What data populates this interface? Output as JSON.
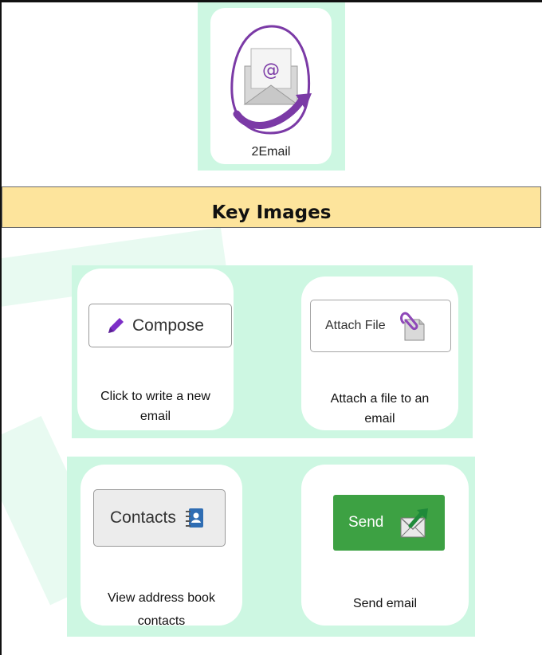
{
  "app": {
    "logo_caption": "2Email"
  },
  "banner": {
    "title": "Key Images"
  },
  "items": [
    {
      "button_label": "Compose",
      "icon": "pencil-icon",
      "caption_line1": "Click to write a new",
      "caption_line2": "email"
    },
    {
      "button_label": "Attach File",
      "icon": "paperclip-file-icon",
      "caption_line1": "Attach a file to an",
      "caption_line2": "email"
    },
    {
      "button_label": "Contacts",
      "icon": "address-book-icon",
      "caption_line1": "View address book",
      "caption_line2": "contacts"
    },
    {
      "button_label": "Send",
      "icon": "envelope-arrow-icon",
      "caption_line1": "Send email",
      "caption_line2": ""
    }
  ],
  "colors": {
    "panel_mint": "#cdf7e2",
    "banner_yellow": "#fde49c",
    "send_green": "#3da143",
    "logo_purple": "#7b3aa6",
    "pencil_purple": "#7d2fc7"
  }
}
